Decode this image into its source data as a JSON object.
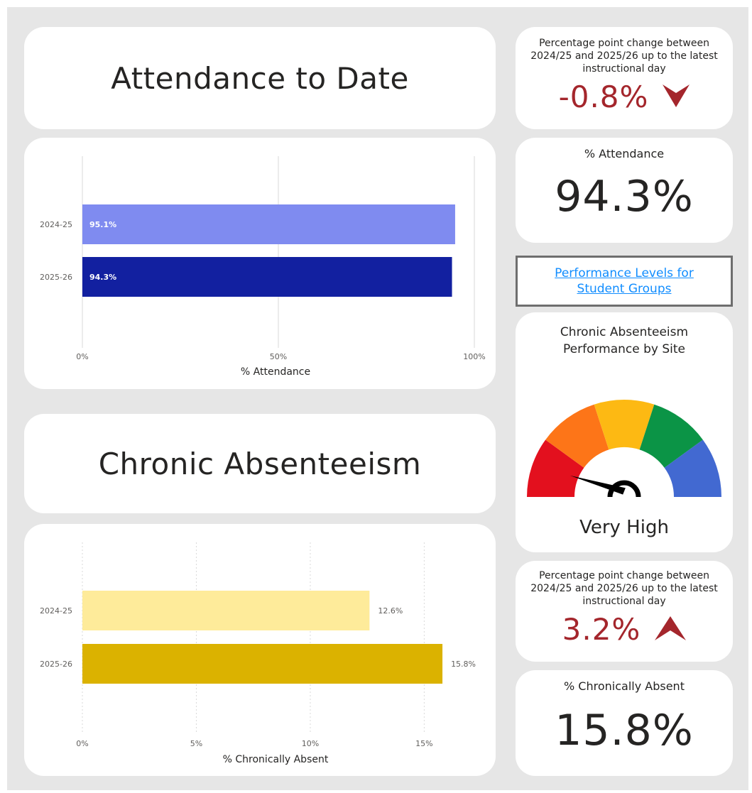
{
  "colors": {
    "bar_2024_att": "#7f8bf0",
    "bar_2025_att": "#1220a0",
    "bar_2024_ca": "#feeb9a",
    "bar_2025_ca": "#dbb200",
    "negative_red": "#a4262c",
    "gauge_segments": [
      "#e3101e",
      "#fd7518",
      "#fdb913",
      "#0b9446",
      "#4269d1"
    ]
  },
  "attendance_title": "Attendance to Date",
  "absenteeism_title": "Chronic Absenteeism",
  "attendance_change": {
    "label": "Percentage point change between 2024/25 and 2025/26 up to the latest instructional day",
    "value": "-0.8%",
    "direction_icon": "arrow-down-icon"
  },
  "attendance_kpi": {
    "label": "% Attendance",
    "value": "94.3%"
  },
  "link": {
    "text": "Performance Levels for Student Groups"
  },
  "gauge": {
    "title": "Chronic Absenteeism Performance by Site",
    "status": "Very High",
    "level_fraction": 0.12
  },
  "absent_change": {
    "label": "Percentage point change between 2024/25 and 2025/26 up to the latest instructional day",
    "value": "3.2%",
    "direction_icon": "arrow-up-icon"
  },
  "absent_kpi": {
    "label": "% Chronically Absent",
    "value": "15.8%"
  },
  "chart_data": [
    {
      "type": "bar",
      "orientation": "horizontal",
      "categories": [
        "2024-25",
        "2025-26"
      ],
      "values": [
        95.1,
        94.3
      ],
      "data_labels": [
        "95.1%",
        "94.3%"
      ],
      "xlabel": "% Attendance",
      "xticks": [
        "0%",
        "50%",
        "100%"
      ],
      "xlim": [
        0,
        100
      ],
      "grid": true
    },
    {
      "type": "bar",
      "orientation": "horizontal",
      "categories": [
        "2024-25",
        "2025-26"
      ],
      "values": [
        12.6,
        15.8
      ],
      "data_labels": [
        "12.6%",
        "15.8%"
      ],
      "xlabel": "% Chronically Absent",
      "xticks": [
        "0%",
        "5%",
        "10%",
        "15%"
      ],
      "xlim": [
        0,
        17.2
      ],
      "grid": true
    }
  ]
}
